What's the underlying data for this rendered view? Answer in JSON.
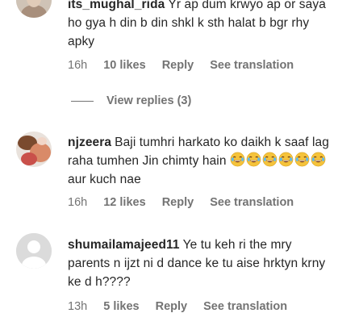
{
  "comments": [
    {
      "username": "its_mughal_rida",
      "text": "Yr ap dum krwyo ap or saya ho gya h din b din shkl k sth halat b bgr rhy apky",
      "time": "16h",
      "likes": "10 likes",
      "reply": "Reply",
      "translate": "See translation",
      "view_replies": "View replies (3)"
    },
    {
      "username": "njzeera",
      "text_before": "Baji tumhri harkato ko daikh k saaf lag raha tumhen Jin chimty hain",
      "emoji_icon": "laughing-crying-emoji",
      "emoji_count": 6,
      "text_after": "aur kuch nae",
      "time": "16h",
      "likes": "12 likes",
      "reply": "Reply",
      "translate": "See translation"
    },
    {
      "username": "shumailamajeed11",
      "text": "Ye tu keh ri the mry parents n ijzt ni d dance ke tu aise hrktyn krny ke d h????",
      "time": "13h",
      "likes": "5 likes",
      "reply": "Reply",
      "translate": "See translation"
    }
  ],
  "colors": {
    "text": "#262626",
    "secondary": "#737373",
    "emoji": "#f5c33b"
  }
}
